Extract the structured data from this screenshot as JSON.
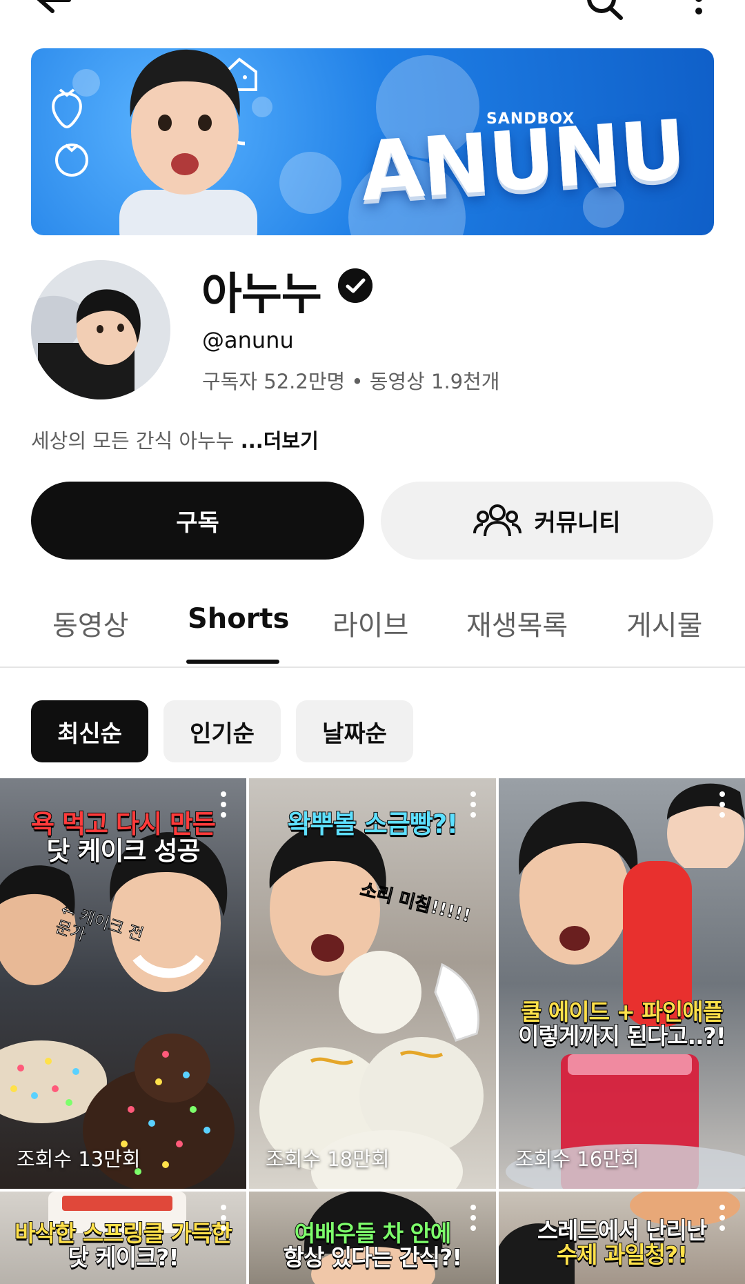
{
  "banner": {
    "brand_small": "SANDBOX",
    "brand": "ANUNU"
  },
  "channel": {
    "name": "아누누",
    "handle": "@anunu",
    "stats": "구독자 52.2만명 • 동영상 1.9천개",
    "description": "세상의 모든 간식 아누누 ",
    "more_label": "...더보기"
  },
  "actions": {
    "subscribe_label": "구독",
    "community_label": "커뮤니티"
  },
  "tabs": [
    {
      "label": "동영상"
    },
    {
      "label": "Shorts"
    },
    {
      "label": "라이브"
    },
    {
      "label": "재생목록"
    },
    {
      "label": "게시물"
    }
  ],
  "active_tab": "Shorts",
  "filters": [
    {
      "label": "최신순",
      "selected": true
    },
    {
      "label": "인기순",
      "selected": false
    },
    {
      "label": "날짜순",
      "selected": false
    }
  ],
  "shorts": [
    {
      "caption_lines": [
        "욕 먹고 다시 만든",
        "닷 케이크 성공"
      ],
      "caption_colors": [
        "#ff3b3b",
        "#ffffff"
      ],
      "side_note": "← 케이크 전문가",
      "views": "조회수 13만회"
    },
    {
      "caption_lines": [
        "왁뿌볼 소금빵?!"
      ],
      "caption_colors": [
        "#5ee0ff"
      ],
      "side_note": "소리 미침!!!!!",
      "views": "조회수 18만회"
    },
    {
      "caption_lines": [
        "쿨 에이드 + 파인애플",
        "이렇게까지 된다고..?!"
      ],
      "caption_colors": [
        "#ffe14a",
        "#ffffff"
      ],
      "side_note": "",
      "views": "조회수 16만회"
    },
    {
      "caption_lines": [
        "바삭한 스프링클 가득한",
        "닷 케이크?!"
      ],
      "caption_colors": [
        "#ffe14a",
        "#ffffff"
      ],
      "side_note": "",
      "views": ""
    },
    {
      "caption_lines": [
        "여배우들 차 안에",
        "항상 있다는 간식?!"
      ],
      "caption_colors": [
        "#7dff6b",
        "#ffffff"
      ],
      "side_note": "",
      "views": ""
    },
    {
      "caption_lines": [
        "스레드에서 난리난",
        "수제 과일청?!"
      ],
      "caption_colors": [
        "#ffffff",
        "#ffe14a"
      ],
      "side_note": "",
      "views": ""
    }
  ],
  "icons": {
    "back": "back-arrow-icon",
    "search": "search-icon",
    "more": "more-vertical-icon",
    "verified": "verified-check-icon",
    "community": "people-icon",
    "short_more": "kebab-icon"
  }
}
